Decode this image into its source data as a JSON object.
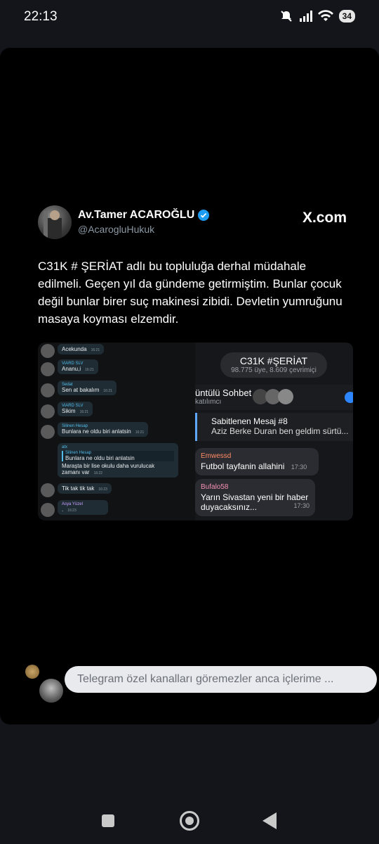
{
  "status_bar": {
    "time": "22:13",
    "battery": "34"
  },
  "tweet": {
    "author_name": "Av.Tamer ACAROĞLU",
    "handle": "@AcarogluHukuk",
    "source": "X.com",
    "text": "C31K # ŞERİAT adlı bu topluluğa derhal müdahale edilmeli. Geçen yıl da gündeme getirmiştim. Bunlar çocuk değil bunlar birer suç makinesi zibidi. Devletin yumruğunu masaya koyması elzemdir."
  },
  "left_chat": {
    "messages": [
      {
        "name": "",
        "text": "Acekunda",
        "time": "16:21"
      },
      {
        "name": "ViARD SLV",
        "text": "Ananu,i",
        "time": "16:21"
      },
      {
        "name": "Sedat",
        "text": "Sen at bakalım",
        "time": "16:21"
      },
      {
        "name": "ViARD SLV",
        "text": "Sikim",
        "time": "16:21"
      },
      {
        "name": "Silinen Hesap",
        "text": "Bunlara ne oldu biri anlatsin",
        "time": "16:21"
      },
      {
        "name": "atx",
        "quote_name": "Silinen Hesap",
        "quote": "Bunlara ne oldu biri anlatsin",
        "text": "Maraşta bir lise okulu daha vurulucak zamanı var",
        "time": "16:22"
      },
      {
        "name": "",
        "text": "Tik tak tik tak",
        "time": "16:23"
      },
      {
        "name": "Asya Yüzel",
        "text": ".",
        "time": "16:23"
      }
    ]
  },
  "right_chat": {
    "group_title": "C31K #ŞERİAT",
    "group_subtitle": "98.775 üye, 8.609 çevrimiçi",
    "voice_chat": "üntülü Sohbet",
    "voice_sub": "katılımcı",
    "pinned_title": "Sabitlenen Mesaj #8",
    "pinned_text": "Aziz Berke Duran ben geldim sürtü...",
    "messages": [
      {
        "name": "Emwessd",
        "text": "Futbol tayfanin allahini",
        "time": "17:30",
        "name_color": "#ff8a65"
      },
      {
        "name": "Bufalo58",
        "text": "Yarın Sivastan yeni bir haber duyacaksınız...",
        "time": "17:30",
        "name_color": "#f48fb1"
      }
    ]
  },
  "comment": {
    "text": "Telegram özel kanalları göremezler anca içlerime ..."
  },
  "colors": {
    "verified": "#1d9bf0",
    "background": "#000000"
  },
  "icons": [
    "mute-icon",
    "signal-icon",
    "wifi-icon",
    "verified-icon",
    "nav-recents-icon",
    "nav-home-icon",
    "nav-back-icon"
  ]
}
